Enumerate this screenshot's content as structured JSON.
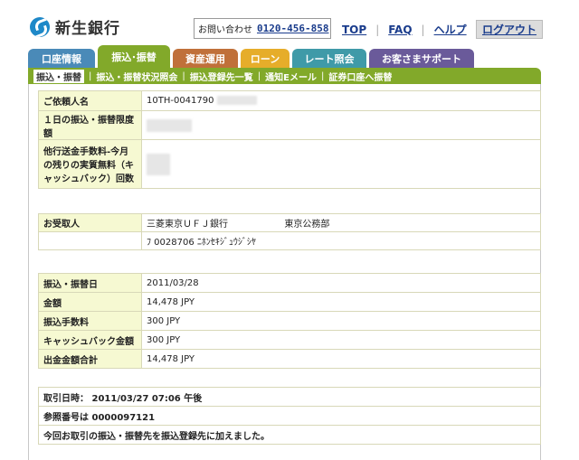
{
  "header": {
    "logo_text": "新生銀行",
    "contact_label": "お問い合わせ",
    "contact_number": "0120-456-858",
    "links": [
      "TOP",
      "FAQ",
      "ヘルプ"
    ],
    "logout": "ログアウト"
  },
  "tabs": [
    {
      "label": "口座情報",
      "color": "#4a8ab8"
    },
    {
      "label": "振込･振替",
      "color": "#82a92a",
      "active": true
    },
    {
      "label": "資産運用",
      "color": "#c0703a"
    },
    {
      "label": "ローン",
      "color": "#e6ad2a"
    },
    {
      "label": "レート照会",
      "color": "#3f9aa8"
    },
    {
      "label": "お客さまサポート",
      "color": "#6a5a9a"
    }
  ],
  "subnav": [
    "振込・振替",
    "振込・振替状況照会",
    "振込登録先一覧",
    "通知Eメール",
    "証券口座へ振替"
  ],
  "requester": {
    "name_label": "ご依頼人名",
    "name_value": "10TH-0041790",
    "limit_label": "１日の振込・振替限度額",
    "fee_free_label": "他行送金手数料-今月の残りの実質無料（キャッシュバック）回数"
  },
  "recipient": {
    "label": "お受取人",
    "bank": "三菱東京ＵＦＪ銀行",
    "branch": "東京公務部",
    "account": "ﾌ 0028706 ﾆﾎﾝｾｷｼﾞｭｳｼﾞｼﾔ"
  },
  "transfer": {
    "date_label": "振込・振替日",
    "date_value": "2011/03/28",
    "amount_label": "金額",
    "amount_value": "14,478 JPY",
    "fee_label": "振込手数料",
    "fee_value": "300 JPY",
    "cashback_label": "キャッシュバック金額",
    "cashback_value": "300 JPY",
    "total_label": "出金金額合計",
    "total_value": "14,478 JPY"
  },
  "result": {
    "datetime": "取引日時： 2011/03/27 07:06 午後",
    "reference": "参照番号は 0000097121",
    "message": "今回お取引の振込・振替先を振込登録先に加えました。"
  }
}
